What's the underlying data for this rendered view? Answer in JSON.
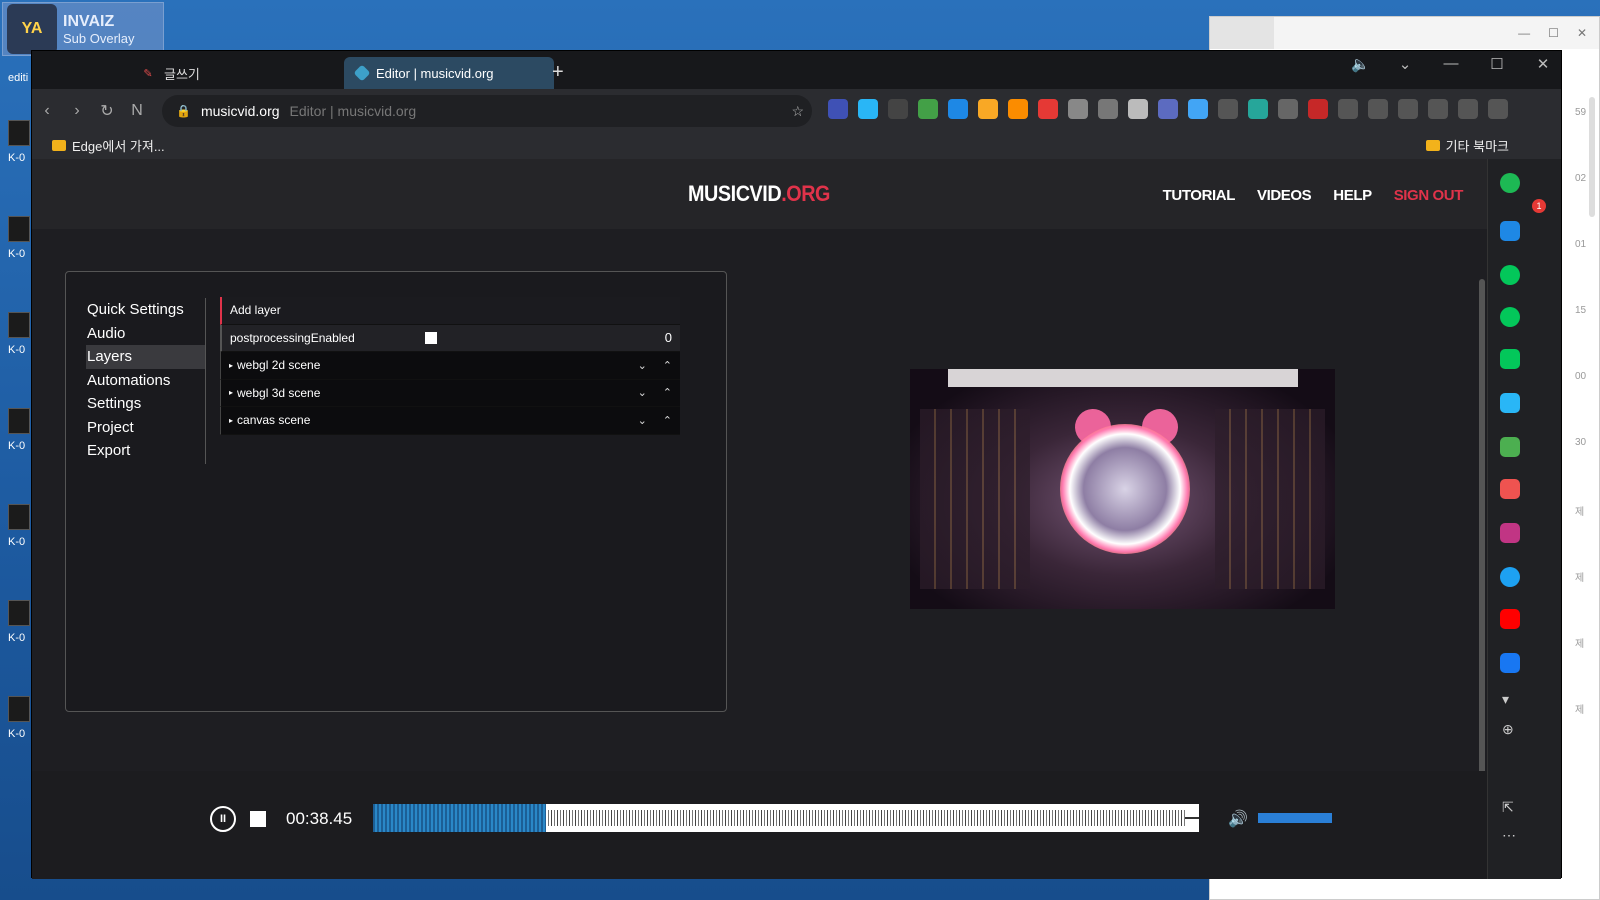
{
  "desktop": {
    "overlay": {
      "title": "INVAIZ",
      "subtitle": "Sub Overlay",
      "logo": "YA"
    },
    "edit_label": "editi",
    "icons": [
      "K-0",
      "K-0",
      "K-0",
      "K-0",
      "K-0",
      "K-0",
      "K-0"
    ]
  },
  "bg_window": {
    "side_numbers": [
      "59",
      "02",
      "01",
      "15",
      "00",
      "30",
      "제",
      "제",
      "제",
      "제"
    ]
  },
  "browser": {
    "tabs": [
      {
        "label": "글쓰기",
        "active": false
      },
      {
        "label": "Editor | musicvid.org",
        "active": true
      }
    ],
    "new_tab": "+",
    "address": {
      "url": "musicvid.org",
      "title": "Editor | musicvid.org"
    },
    "bookmarks": {
      "left": "Edge에서 가져...",
      "right": "기타 북마크"
    }
  },
  "site": {
    "brand": {
      "part1": "MUSICVID",
      "part2": ".ORG"
    },
    "nav": [
      "TUTORIAL",
      "VIDEOS",
      "HELP"
    ],
    "signout": "SIGN OUT",
    "menu": [
      "Quick Settings",
      "Audio",
      "Layers",
      "Automations",
      "Settings",
      "Project",
      "Export"
    ],
    "selected_menu": "Layers",
    "layers": {
      "add_label": "Add layer",
      "postprocessing_label": "postprocessingEnabled",
      "postprocessing_count": "0",
      "scenes": [
        "webgl 2d scene",
        "webgl 3d scene",
        "canvas scene"
      ]
    },
    "player": {
      "time": "00:38.45",
      "progress_fraction": 0.21,
      "volume_fraction": 1.0
    }
  },
  "sidebar": {
    "badge_count": "1"
  },
  "colors": {
    "accent": "#e0334a",
    "player_blue": "#2a7fd6"
  }
}
